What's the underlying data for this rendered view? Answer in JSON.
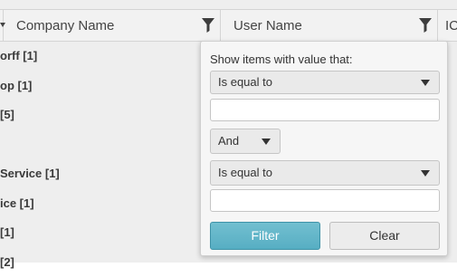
{
  "grid": {
    "columns": [
      {
        "label": "Company Name",
        "has_filter": true,
        "filter_icon": "filter-funnel-icon"
      },
      {
        "label": "User Name",
        "has_filter": true,
        "filter_icon": "filter-funnel-icon"
      },
      {
        "label": "IC",
        "has_filter": false
      }
    ],
    "group_rows": [
      "orff [1]",
      "op [1]",
      "[5]",
      "",
      "Service [1]",
      "ice [1]",
      " [1]",
      "[2]"
    ]
  },
  "filter_popup": {
    "caption": "Show items with value that:",
    "first_operator": "Is equal to",
    "first_value": "",
    "logic_operator": "And",
    "second_operator": "Is equal to",
    "second_value": "",
    "filter_button": "Filter",
    "clear_button": "Clear",
    "colors": {
      "filter_button_bg": "#5fb4c8",
      "filter_button_text": "#ffffff"
    }
  }
}
